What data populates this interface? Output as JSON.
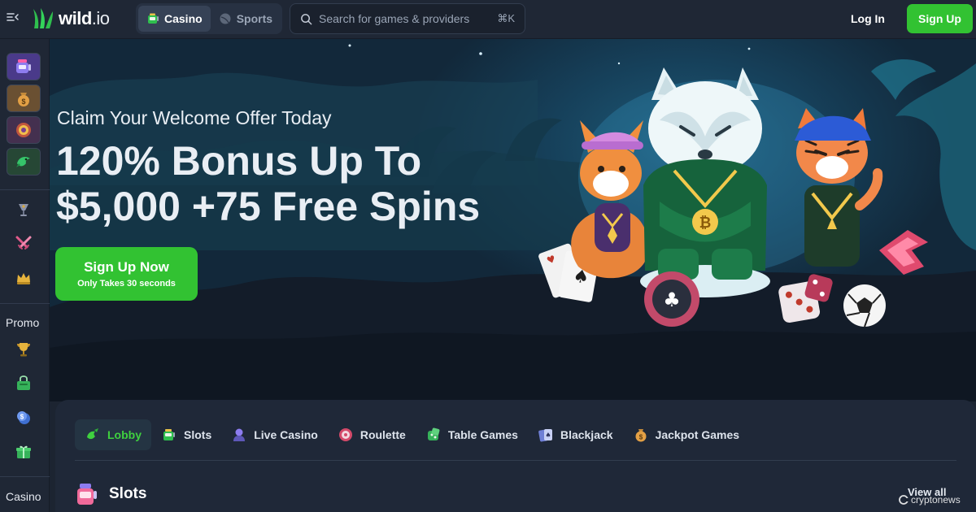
{
  "header": {
    "brand": {
      "name": "wild",
      "tld": ".io"
    },
    "modes": [
      {
        "label": "Casino",
        "active": true
      },
      {
        "label": "Sports",
        "active": false
      }
    ],
    "search": {
      "placeholder": "Search for games & providers",
      "shortcut": "⌘K"
    },
    "login_label": "Log In",
    "signup_label": "Sign Up"
  },
  "sidebar": {
    "game_icons": [
      "slot-machine-icon",
      "money-bag-icon",
      "roulette-icon",
      "dragon-icon"
    ],
    "nav_icons": [
      "trophy-cup-icon",
      "swords-icon",
      "crown-icon"
    ],
    "promo_heading": "Promo",
    "promo_icons": [
      "trophy-icon",
      "shopping-basket-icon",
      "coin-icon",
      "gift-icon"
    ],
    "casino_heading": "Casino"
  },
  "hero": {
    "subtitle": "Claim Your Welcome Offer Today",
    "title_line1": "120% Bonus Up To",
    "title_line2": "$5,000 +75 Free Spins",
    "cta_main": "Sign Up Now",
    "cta_sub": "Only Takes 30 seconds"
  },
  "lobby": {
    "tabs": [
      {
        "label": "Lobby",
        "icon": "lobby-icon",
        "active": true
      },
      {
        "label": "Slots",
        "icon": "slots-icon",
        "active": false
      },
      {
        "label": "Live Casino",
        "icon": "live-dealer-icon",
        "active": false
      },
      {
        "label": "Roulette",
        "icon": "roulette-icon",
        "active": false
      },
      {
        "label": "Table Games",
        "icon": "table-games-icon",
        "active": false
      },
      {
        "label": "Blackjack",
        "icon": "blackjack-icon",
        "active": false
      },
      {
        "label": "Jackpot Games",
        "icon": "jackpot-icon",
        "active": false
      }
    ],
    "section_title": "Slots",
    "view_all": "View all"
  },
  "watermark": "cryptonews",
  "colors": {
    "brand_green": "#32c232",
    "active_tab_green": "#3fd13f",
    "background": "#1c2431",
    "panel": "#1f2838"
  }
}
